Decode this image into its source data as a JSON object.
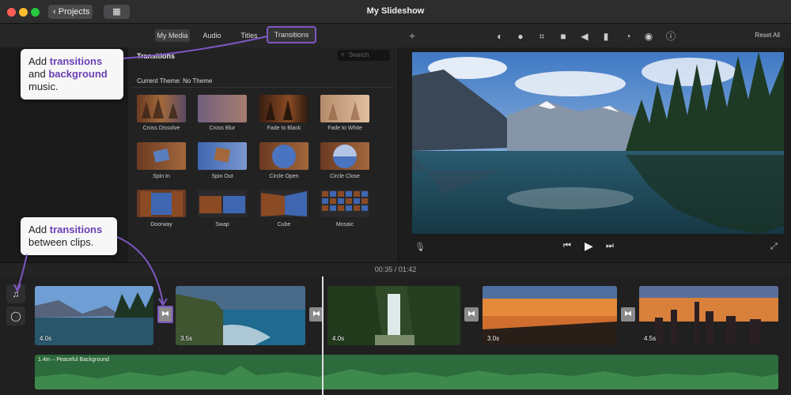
{
  "window": {
    "title": "My Slideshow",
    "projects_label": "Projects"
  },
  "tabs": [
    {
      "label": "My Media"
    },
    {
      "label": "Audio"
    },
    {
      "label": "Titles"
    },
    {
      "label": "Transitions"
    }
  ],
  "toolbar": {
    "reset_label": "Reset All"
  },
  "browser": {
    "title": "Transitions",
    "search_placeholder": "Search",
    "theme": "Current Theme: No Theme",
    "transitions": [
      {
        "label": "Cross Dissolve"
      },
      {
        "label": "Cross Blur"
      },
      {
        "label": "Fade to Black"
      },
      {
        "label": "Fade to White"
      },
      {
        "label": "Spin In"
      },
      {
        "label": "Spin Out"
      },
      {
        "label": "Circle Open"
      },
      {
        "label": "Circle Close"
      },
      {
        "label": "Doorway"
      },
      {
        "label": "Swap"
      },
      {
        "label": "Cube"
      },
      {
        "label": "Mosaic"
      }
    ]
  },
  "timecode": {
    "current": "00:35",
    "separator": "/",
    "total": "01:42"
  },
  "clips": [
    {
      "duration": "4.0s"
    },
    {
      "duration": "3.5s"
    },
    {
      "duration": "4.0s"
    },
    {
      "duration": "3.0s"
    },
    {
      "duration": "4.5s"
    }
  ],
  "audio_track": {
    "label": "1.4m – Peaceful Background"
  },
  "callouts": {
    "top": {
      "t1": "Add ",
      "h1": "transitions",
      "t2": "and ",
      "h2": "background",
      "t3": "music."
    },
    "bottom": {
      "t1": "Add ",
      "h1": "transitions",
      "t2": "between clips."
    }
  },
  "colors": {
    "accent": "#7e57c2",
    "highlight_text": "#6a3fb5",
    "audio_wave": "#2c6b3b"
  }
}
